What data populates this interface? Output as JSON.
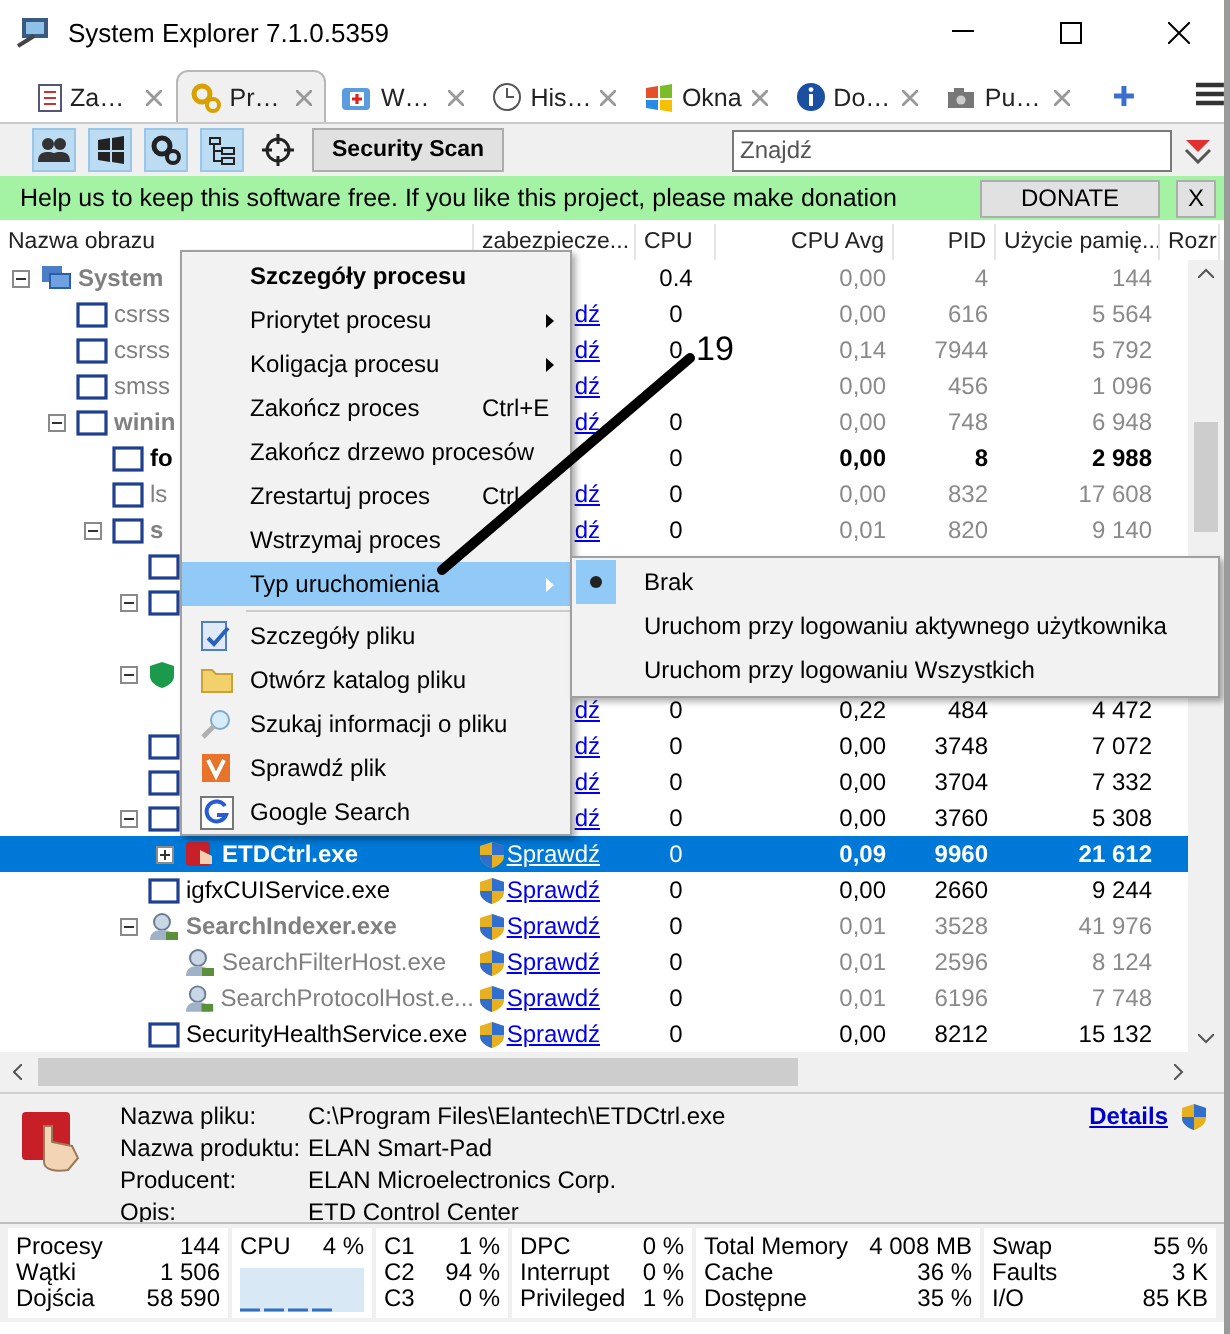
{
  "window": {
    "title": "System Explorer 7.1.0.5359"
  },
  "tabs": [
    {
      "label": "Za…",
      "selected": false
    },
    {
      "label": "Pr…",
      "selected": true
    },
    {
      "label": "W…",
      "selected": false
    },
    {
      "label": "His…",
      "selected": false
    },
    {
      "label": "Okna",
      "selected": false
    },
    {
      "label": "Do…",
      "selected": false
    },
    {
      "label": "Pu…",
      "selected": false
    }
  ],
  "toolbar": {
    "toggles": [
      {
        "pressed": true
      },
      {
        "pressed": true
      },
      {
        "pressed": true
      },
      {
        "pressed": true
      },
      {
        "pressed": false
      }
    ],
    "scan_button": "Security Scan",
    "search": {
      "placeholder": "Znajdź"
    }
  },
  "banner": {
    "message": "Help us to keep this software free.  If you like this project, please make donation",
    "donate_button": "DONATE",
    "close_button": "X"
  },
  "table": {
    "columns": [
      "Nazwa obrazu",
      "zabezpiecze...",
      "CPU",
      "CPU Avg",
      "PID",
      "Użycie pamię...",
      "Rozr"
    ],
    "rows": [
      {
        "name": "System",
        "kind": "computer",
        "bold": true,
        "dimmed": true,
        "selected": false,
        "expanded": true,
        "cpu": "0.4",
        "cpu_avg": "0,00",
        "pid": "4",
        "memory": "144",
        "children": [
          {
            "name": "csrss",
            "kind": "window",
            "bold": false,
            "dimmed": true,
            "selected": false,
            "cpu": "0",
            "cpu_avg": "0,00",
            "pid": "616",
            "memory": "5 564",
            "security": "dź",
            "signed": false
          },
          {
            "name": "csrss",
            "kind": "window",
            "bold": false,
            "dimmed": true,
            "selected": false,
            "cpu": "0",
            "cpu_avg": "0,14",
            "pid": "7944",
            "memory": "5 792",
            "security": "dź",
            "signed": false
          },
          {
            "name": "smss",
            "kind": "window",
            "bold": false,
            "dimmed": true,
            "selected": false,
            "cpu_avg": "0,00",
            "pid": "456",
            "memory": "1 096",
            "security": "dź",
            "signed": false
          },
          {
            "name": "winin",
            "kind": "window",
            "bold": true,
            "dimmed": true,
            "selected": false,
            "expanded": true,
            "cpu": "0",
            "cpu_avg": "0,00",
            "pid": "748",
            "memory": "6 948",
            "security": "dź",
            "signed": false,
            "children": [
              {
                "name": "fo",
                "kind": "window",
                "bold": true,
                "dimmed": false,
                "selected": false,
                "cpu": "0",
                "cpu_avg": "0,00",
                "pid": "8",
                "memory": "2 988"
              },
              {
                "name": "ls",
                "kind": "window",
                "bold": false,
                "dimmed": true,
                "selected": false,
                "cpu": "0",
                "cpu_avg": "0,00",
                "pid": "832",
                "memory": "17 608",
                "security": "dź",
                "signed": false
              },
              {
                "name": "s",
                "kind": "window",
                "bold": true,
                "dimmed": true,
                "selected": false,
                "expanded": true,
                "cpu": "0",
                "cpu_avg": "0,01",
                "pid": "820",
                "memory": "9 140",
                "security": "dź",
                "signed": false,
                "children": [
                  {
                    "kind": "window",
                    "selected": false
                  },
                  {
                    "kind": "window",
                    "selected": false,
                    "expanded": true,
                    "children": [
                      {
                        "kind": "none",
                        "selected": false
                      }
                    ]
                  },
                  {
                    "kind": "shield",
                    "selected": false,
                    "expanded": true,
                    "children": [
                      {
                        "kind": "none",
                        "selected": false,
                        "cpu": "0",
                        "cpu_avg": "0,22",
                        "pid": "484",
                        "memory": "4 472",
                        "security": "dź",
                        "signed": false
                      }
                    ]
                  },
                  {
                    "kind": "window",
                    "selected": false,
                    "cpu": "0",
                    "cpu_avg": "0,00",
                    "pid": "3748",
                    "memory": "7 072",
                    "security": "dź",
                    "signed": false
                  },
                  {
                    "kind": "window",
                    "selected": false,
                    "cpu": "0",
                    "cpu_avg": "0,00",
                    "pid": "3704",
                    "memory": "7 332",
                    "security": "dź",
                    "signed": false
                  },
                  {
                    "kind": "window",
                    "selected": false,
                    "expanded": true,
                    "cpu": "0",
                    "cpu_avg": "0,00",
                    "pid": "3760",
                    "memory": "5 308",
                    "security": "dź",
                    "signed": false,
                    "children": [
                      {
                        "name": "ETDCtrl.exe",
                        "kind": "app",
                        "bold": true,
                        "selected": true,
                        "expanded": false,
                        "cpu": "0",
                        "cpu_avg": "0,09",
                        "pid": "9960",
                        "memory": "21 612",
                        "security": "Sprawdź",
                        "signed": true
                      }
                    ]
                  },
                  {
                    "name": "igfxCUIService.exe",
                    "kind": "window",
                    "bold": false,
                    "dimmed": false,
                    "selected": false,
                    "cpu": "0",
                    "cpu_avg": "0,00",
                    "pid": "2660",
                    "memory": "9 244",
                    "security": "Sprawdź",
                    "signed": true
                  },
                  {
                    "name": "SearchIndexer.exe",
                    "kind": "user",
                    "bold": true,
                    "dimmed": true,
                    "selected": false,
                    "expanded": true,
                    "cpu": "0",
                    "cpu_avg": "0,01",
                    "pid": "3528",
                    "memory": "41 976",
                    "security": "Sprawdź",
                    "signed": true,
                    "children": [
                      {
                        "name": "SearchFilterHost.exe",
                        "kind": "user",
                        "bold": false,
                        "dimmed": true,
                        "selected": false,
                        "cpu": "0",
                        "cpu_avg": "0,01",
                        "pid": "2596",
                        "memory": "8 124",
                        "security": "Sprawdź",
                        "signed": true
                      },
                      {
                        "name": "SearchProtocolHost.e...",
                        "kind": "user",
                        "bold": false,
                        "dimmed": true,
                        "selected": false,
                        "cpu": "0",
                        "cpu_avg": "0,01",
                        "pid": "6196",
                        "memory": "7 748",
                        "security": "Sprawdź",
                        "signed": true
                      }
                    ]
                  },
                  {
                    "name": "SecurityHealthService.exe",
                    "kind": "window",
                    "bold": false,
                    "dimmed": false,
                    "selected": false,
                    "cpu": "0",
                    "cpu_avg": "0,00",
                    "pid": "8212",
                    "memory": "15 132",
                    "security": "Sprawdź",
                    "signed": true
                  }
                ]
              }
            ]
          }
        ]
      }
    ]
  },
  "context_menu": {
    "items": [
      {
        "kind": "title",
        "label": "Szczegóły procesu"
      },
      {
        "kind": "submenu",
        "label": "Priorytet procesu",
        "highlighted": false
      },
      {
        "kind": "submenu",
        "label": "Koligacja procesu",
        "highlighted": false
      },
      {
        "kind": "action",
        "label": "Zakończ proces",
        "shortcut": "Ctrl+E"
      },
      {
        "kind": "action",
        "label": "Zakończ drzewo procesów"
      },
      {
        "kind": "action",
        "label": "Zrestartuj proces",
        "shortcut": "Ctrl"
      },
      {
        "kind": "action",
        "label": "Wstrzymaj proces"
      },
      {
        "kind": "submenu",
        "label": "Typ uruchomienia",
        "highlighted": true
      },
      {
        "kind": "separator"
      },
      {
        "kind": "icon-action",
        "label": "Szczegóły pliku"
      },
      {
        "kind": "icon-action",
        "label": "Otwórz katalog pliku"
      },
      {
        "kind": "icon-action",
        "label": "Szukaj informacji o pliku"
      },
      {
        "kind": "icon-action",
        "label": "Sprawdź plik"
      },
      {
        "kind": "icon-action",
        "label": "Google Search"
      }
    ]
  },
  "submenu": {
    "items": [
      {
        "label": "Brak",
        "selected": true
      },
      {
        "label": "Uruchom przy logowaniu aktywnego użytkownika",
        "selected": false
      },
      {
        "label": "Uruchom przy logowaniu Wszystkich",
        "selected": false
      }
    ]
  },
  "annotation": {
    "label": "19"
  },
  "details": {
    "fields": [
      {
        "label": "Nazwa pliku:",
        "value": "C:\\Program Files\\Elantech\\ETDCtrl.exe"
      },
      {
        "label": "Nazwa produktu:",
        "value": "ELAN Smart-Pad"
      },
      {
        "label": "Producent:",
        "value": "ELAN Microelectronics Corp."
      },
      {
        "label": "Opis:",
        "value": "ETD Control Center"
      }
    ],
    "link": "Details"
  },
  "status_bar": {
    "groups": [
      {
        "kind": "stats",
        "items": [
          {
            "label": "Procesy",
            "value": "144"
          },
          {
            "label": "Wątki",
            "value": "1 506"
          },
          {
            "label": "Dojścia",
            "value": "58 590"
          }
        ]
      },
      {
        "kind": "graph",
        "items": [
          {
            "label": "CPU",
            "value": "4 %"
          }
        ]
      },
      {
        "kind": "stats",
        "items": [
          {
            "label": "C1",
            "value": "1 %"
          },
          {
            "label": "C2",
            "value": "94 %"
          },
          {
            "label": "C3",
            "value": "0 %"
          }
        ]
      },
      {
        "kind": "stats",
        "items": [
          {
            "label": "DPC",
            "value": "0 %"
          },
          {
            "label": "Interrupt",
            "value": "0 %"
          },
          {
            "label": "Privileged",
            "value": "1 %"
          }
        ]
      },
      {
        "kind": "stats",
        "items": [
          {
            "label": "Total Memory",
            "value": "4 008 MB"
          },
          {
            "label": "Cache",
            "value": "36 %"
          },
          {
            "label": "Dostępne",
            "value": "35 %"
          }
        ]
      },
      {
        "kind": "stats",
        "items": [
          {
            "label": "Swap",
            "value": "55 %"
          },
          {
            "label": "Faults",
            "value": "3 K"
          },
          {
            "label": "I/O",
            "value": "85 KB"
          }
        ]
      }
    ]
  }
}
